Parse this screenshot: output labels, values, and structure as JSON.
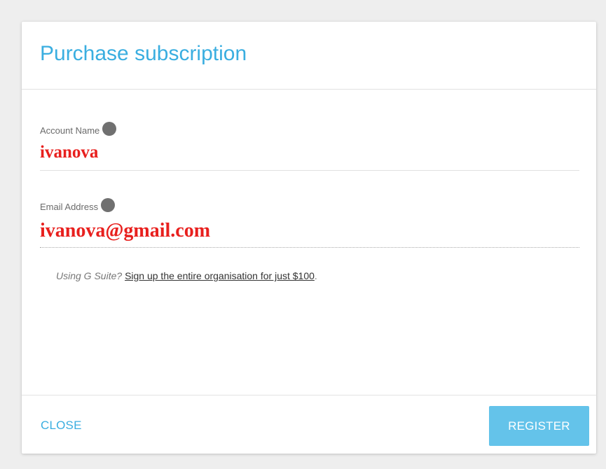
{
  "dialog": {
    "title": "Purchase subscription"
  },
  "fields": {
    "account_name": {
      "label": "Account Name",
      "value": "ivanova",
      "icon": "info-icon"
    },
    "email_address": {
      "label": "Email Address",
      "value": "ivanova@gmail.com",
      "icon": "info-icon"
    }
  },
  "hint": {
    "question": "Using G Suite?",
    "link_text": "Sign up the entire organisation for just $100",
    "suffix": "."
  },
  "footer": {
    "close_label": "CLOSE",
    "register_label": "REGISTER"
  },
  "colors": {
    "accent": "#3aaee0",
    "register_button": "#64c3ea",
    "value_text": "#e8201e",
    "info_icon": "#707070",
    "background": "#eeeeee"
  }
}
